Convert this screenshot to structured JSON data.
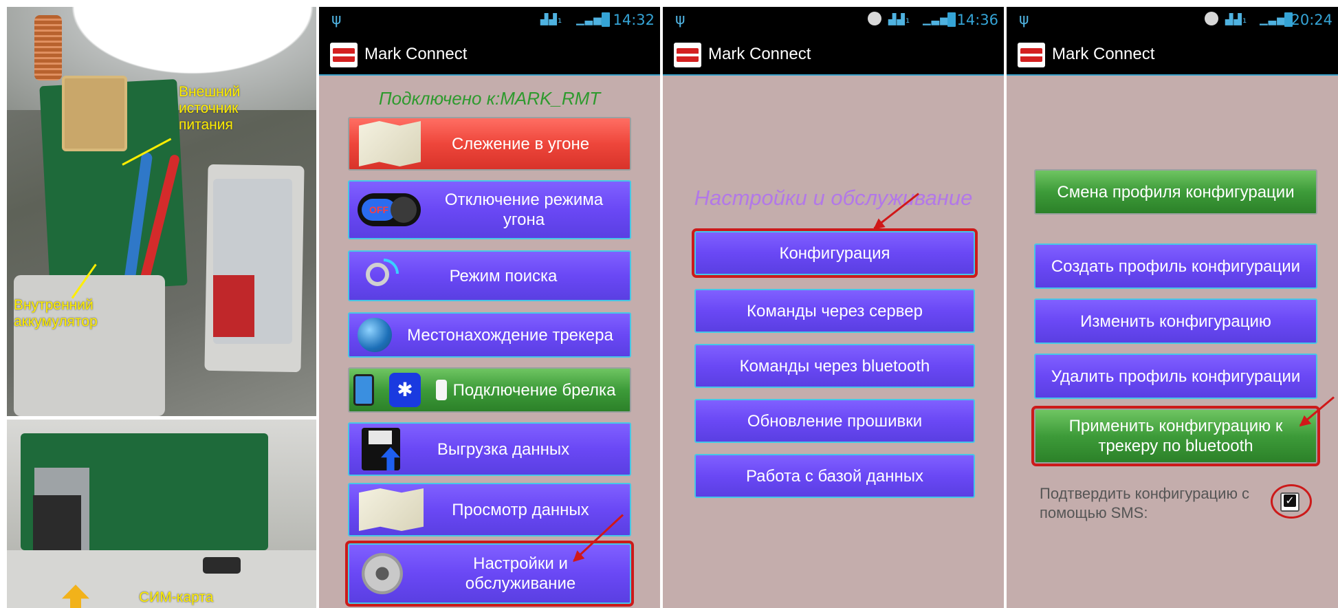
{
  "photos": {
    "labels": {
      "external_power": "Внешний\nисточник\nпитания",
      "internal_battery": "Внутренний\nаккумулятор",
      "sim_card": "СИМ-карта"
    }
  },
  "status_bars": [
    {
      "time": "14:32"
    },
    {
      "time": "14:36"
    },
    {
      "time": "20:24"
    }
  ],
  "app": {
    "title": "Mark Connect"
  },
  "screen1": {
    "status_text": "Подключено к:MARK_RMT",
    "buttons": [
      {
        "label": "Слежение в угоне",
        "color": "#e8453a"
      },
      {
        "label": "Отключение режима угона",
        "color": "#6a48f5"
      },
      {
        "label": "Режим поиска",
        "color": "#6a48f5"
      },
      {
        "label": "Местонахождение трекера",
        "color": "#6a48f5"
      },
      {
        "label": "Подключение брелка",
        "color": "#3d9b39"
      },
      {
        "label": "Выгрузка данных",
        "color": "#6a48f5"
      },
      {
        "label": "Просмотр данных",
        "color": "#6a48f5"
      },
      {
        "label": "Настройки и обслуживание",
        "color": "#6a48f5"
      }
    ],
    "off_toggle_text": "OFF"
  },
  "screen2": {
    "heading": "Настройки и обслуживание",
    "buttons": [
      {
        "label": "Конфигурация"
      },
      {
        "label": "Команды через сервер"
      },
      {
        "label": "Команды через bluetooth"
      },
      {
        "label": "Обновление прошивки"
      },
      {
        "label": "Работа с базой данных"
      }
    ]
  },
  "screen3": {
    "buttons": [
      {
        "label": "Смена профиля конфигурации",
        "color": "#3d9b39"
      },
      {
        "label": "Создать профиль конфигурации",
        "color": "#6a48f5"
      },
      {
        "label": "Изменить конфигурацию",
        "color": "#6a48f5"
      },
      {
        "label": "Удалить профиль конфигурации",
        "color": "#6a48f5"
      },
      {
        "label": "Применить конфигурацию к трекеру по bluetooth",
        "color": "#3d9b39"
      }
    ],
    "sms_confirm": {
      "label": "Подтвердить конфигурацию с помощью SMS:",
      "checked": true
    }
  },
  "colors": {
    "screen_bg": "#c4adac",
    "status_text": "#2e9a2e",
    "heading": "#b278e8",
    "highlight": "#cc1a1a",
    "label_yellow": "#ffee00"
  }
}
